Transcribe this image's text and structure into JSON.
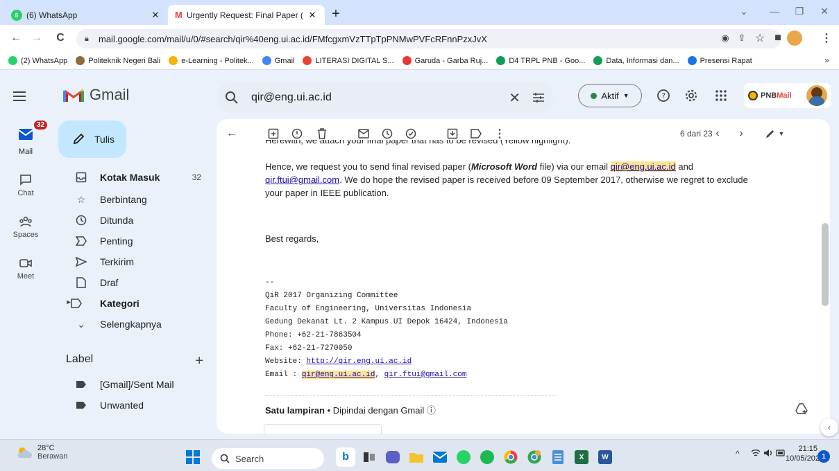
{
  "browser": {
    "tabs": [
      {
        "title": "(6) WhatsApp",
        "badge": "6"
      },
      {
        "title": "Urgently Request: Final Paper (W"
      }
    ],
    "url": "mail.google.com/mail/u/0/#search/qir%40eng.ui.ac.id/FMfcgxmVzTTpTpPNMwPVFcRFnnPzxJvX",
    "bookmarks": [
      {
        "label": "(2) WhatsApp",
        "color": "#25d366"
      },
      {
        "label": "Politeknik Negeri Bali",
        "color": "#8a6d3b"
      },
      {
        "label": "e-Learning - Politek...",
        "color": "#f4b400"
      },
      {
        "label": "Gmail",
        "color": "#4285f4"
      },
      {
        "label": "LITERASI DIGITAL S...",
        "color": "#ea4335"
      },
      {
        "label": "Garuda - Garba Ruj...",
        "color": "#e53935"
      },
      {
        "label": "D4 TRPL PNB - Goo...",
        "color": "#0f9d58"
      },
      {
        "label": "Data, Informasi dan...",
        "color": "#0f9d58"
      },
      {
        "label": "Presensi Rapat",
        "color": "#1a73e8"
      }
    ]
  },
  "gmail": {
    "logo": "Gmail",
    "search_value": "qir@eng.ui.ac.id",
    "status": "Aktif",
    "account_label": "PNB Mail",
    "rail": [
      {
        "label": "Mail",
        "badge": "32"
      },
      {
        "label": "Chat"
      },
      {
        "label": "Spaces"
      },
      {
        "label": "Meet"
      }
    ],
    "compose": "Tulis",
    "folders": [
      {
        "label": "Kotak Masuk",
        "count": "32"
      },
      {
        "label": "Berbintang"
      },
      {
        "label": "Ditunda"
      },
      {
        "label": "Penting"
      },
      {
        "label": "Terkirim"
      },
      {
        "label": "Draf"
      },
      {
        "label": "Kategori"
      },
      {
        "label": "Selengkapnya"
      }
    ],
    "label_header": "Label",
    "labels": [
      "[Gmail]/Sent Mail",
      "Unwanted"
    ],
    "pager": "6 dari 23"
  },
  "message": {
    "cut_line": "Herewith, we attach your final paper that has to be revised (Yellow highlight).",
    "p1_a": "Hence, we request you to send final revised paper (",
    "p1_b": "Microsoft Word",
    "p1_c": " file) via our email ",
    "email1": "qir@eng.ui.ac.id",
    "p1_d": " and",
    "email2": "qir.ftui@gmail.com",
    "p1_e": ". We do hope the revised paper is received before 09 September 2017, otherwise we regret to exclude",
    "p1_f": "your paper in IEEE publication.",
    "regards": "Best regards,",
    "sig_dash": "--",
    "sig_org": "QiR 2017 Organizing Committee",
    "sig_fac": "Faculty of Engineering, Universitas Indonesia",
    "sig_addr": "Gedung Dekanat Lt. 2 Kampus UI Depok 16424, Indonesia",
    "sig_phone": "Phone: +62-21-7863504",
    "sig_fax": "Fax: +62-21-7270050",
    "sig_web_label": "Website: ",
    "sig_web": "http://qir.eng.ui.ac.id",
    "sig_email_label": "Email : ",
    "sig_email1": "qir@eng.ui.ac.id",
    "sig_email_sep": ", ",
    "sig_email2": "qir.ftui@gmail.com",
    "attach_title": "Satu lampiran",
    "attach_note": " • Dipindai dengan Gmail ⓘ"
  },
  "taskbar": {
    "temp": "28°C",
    "weather": "Berawan",
    "search": "Search",
    "time": "21:15",
    "date": "10/05/2023",
    "notifications": "1"
  }
}
